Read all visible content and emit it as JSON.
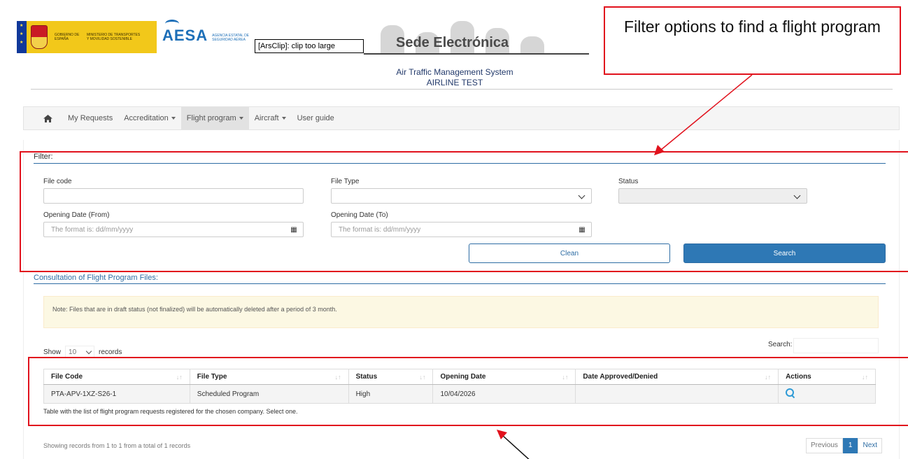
{
  "header": {
    "gov_text": "GOBIERNO DE ESPAÑA",
    "ministry_text": "MINISTERIO DE TRANSPORTES Y MOVILIDAD SOSTENIBLE",
    "aesa_word": "AESA",
    "aesa_sub": "AGENCIA ESTATAL DE SEGURIDAD AÉREA",
    "arsclip": "[ArsClip]: clip too large",
    "sede_title": "Sede Electrónica",
    "app_title": "Air Traffic Management System",
    "app_subtitle": "AIRLINE TEST"
  },
  "callout": {
    "text": "Filter options to find a flight program",
    "color": "#e1121d"
  },
  "nav": {
    "items": [
      {
        "label": "My Requests",
        "dropdown": false
      },
      {
        "label": "Accreditation",
        "dropdown": true
      },
      {
        "label": "Flight program",
        "dropdown": true,
        "active": true
      },
      {
        "label": "Aircraft",
        "dropdown": true
      },
      {
        "label": "User guide",
        "dropdown": false
      }
    ]
  },
  "filter": {
    "title": "Filter:",
    "file_code_label": "File code",
    "file_code_value": "",
    "file_type_label": "File Type",
    "file_type_value": "",
    "status_label": "Status",
    "status_value": "",
    "date_from_label": "Opening Date (From)",
    "date_from_placeholder": "The format is: dd/mm/yyyy",
    "date_to_label": "Opening Date (To)",
    "date_to_placeholder": "The format is: dd/mm/yyyy",
    "clean_label": "Clean",
    "search_label": "Search"
  },
  "consultation": {
    "title": "Consultation of Flight Program Files:",
    "note": "Note: Files that are in draft status (not finalized) will be automatically deleted after a period of 3 month.",
    "show_label": "Show",
    "page_length": "10",
    "records_label": "records",
    "search_label": "Search:",
    "columns": [
      "File Code",
      "File Type",
      "Status",
      "Opening Date",
      "Date Approved/Denied",
      "Actions"
    ],
    "rows": [
      {
        "file_code": "PTA-APV-1XZ-S26-1",
        "file_type": "Scheduled Program",
        "status": "High",
        "opening_date": "10/04/2026",
        "date_approved": ""
      }
    ],
    "caption": "Table with the list of flight program requests registered for the chosen company. Select one.",
    "showing": "Showing records from 1 to 1 from a total of 1 records",
    "pager": {
      "previous": "Previous",
      "current": "1",
      "next": "Next"
    }
  },
  "colors": {
    "accent": "#2e78b5",
    "annotation": "#e1121d",
    "note_bg": "#fcf8e3"
  }
}
